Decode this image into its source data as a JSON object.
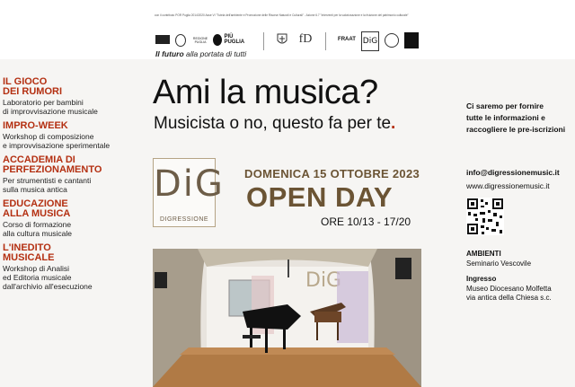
{
  "header": {
    "fine_print": "con il contributo POR Puglia 2014/2020 Asse VI \"Tutela dell'ambiente e Promozione delle Risorse Naturali e Culturali\" - Azione 6.7 \"Interventi per la valorizzazione e la fruizione del patrimonio culturale\"",
    "logo_region_text": "REGIONE PUGLIA",
    "logo_puglia_text": "PIÙ PUGLIA",
    "logo_fd_text": "fD",
    "logo_fraat_text": "FRAAT",
    "logo_dig_text": "DiG",
    "tagline_bold": "Il futuro",
    "tagline_rest": " alla portata di tutti"
  },
  "courses": [
    {
      "title_line1": "IL GIOCO",
      "title_line2": "DEI RUMORI",
      "desc_line1": "Laboratorio per bambini",
      "desc_line2": "di improvvisazione musicale",
      "desc_line3": ""
    },
    {
      "title_line1": "IMPRO-WEEK",
      "title_line2": "",
      "desc_line1": "Workshop di composizione",
      "desc_line2": "e improvvisazione sperimentale",
      "desc_line3": ""
    },
    {
      "title_line1": "ACCADEMIA DI",
      "title_line2": "PERFEZIONAMENTO",
      "desc_line1": "Per strumentisti e cantanti",
      "desc_line2": "sulla musica antica",
      "desc_line3": ""
    },
    {
      "title_line1": "EDUCAZIONE",
      "title_line2": "ALLA MUSICA",
      "desc_line1": "Corso di formazione",
      "desc_line2": "alla cultura musicale",
      "desc_line3": ""
    },
    {
      "title_line1": "L'INEDITO",
      "title_line2": "MUSICALE",
      "desc_line1": "Workshop di Analisi",
      "desc_line2": "ed Editoria musicale",
      "desc_line3": "dall'archivio all'esecuzione"
    }
  ],
  "center": {
    "headline": "Ami la musica?",
    "subline": "Musicista o no, questo fa per te",
    "subline_dot": ".",
    "dig_letters": "DiG",
    "dig_word": "DIGRESSIONE",
    "date_line": "DOMENICA 15 OTTOBRE 2023",
    "open_day": "OPEN DAY",
    "time_line": "ORE 10/13 - 17/20",
    "photo_sign": "DiG"
  },
  "right": {
    "info_line1": "Ci saremo per fornire",
    "info_line2": "tutte le informazioni e",
    "info_line3": "raccogliere le pre-iscrizioni",
    "email": "info@digressionemusic.it",
    "website": "www.digressionemusic.it",
    "ambienti_label": "AMBIENTI",
    "ambienti_value": "Seminario Vescovile",
    "ingresso_label": "Ingresso",
    "museo_line1": "Museo Diocesano Molfetta",
    "museo_line2": "via antica della Chiesa s.c."
  },
  "colors": {
    "accent_red": "#b43012",
    "brown": "#6b5434",
    "background": "#f6f5f3"
  }
}
